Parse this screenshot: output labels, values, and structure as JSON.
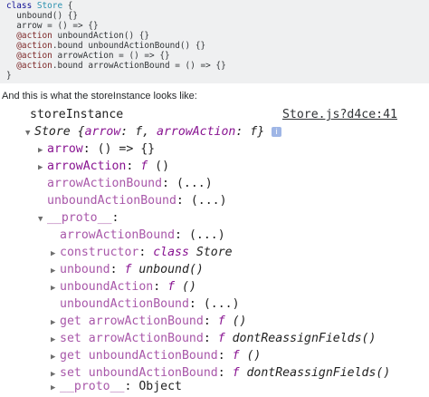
{
  "code_block": {
    "lines": [
      [
        "class ",
        "Store",
        " {"
      ],
      [
        "  unbound() {}"
      ],
      [
        "  arrow = () => {}"
      ],
      [
        "  @action",
        " unboundAction() {}"
      ],
      [
        "  @action",
        ".bound unboundActionBound() {}"
      ],
      [
        "  @action",
        " arrowAction = () => {}"
      ],
      [
        "  @action",
        ".bound arrowActionBound = () => {}"
      ],
      [
        "}"
      ]
    ]
  },
  "caption": "And this is what the storeInstance looks like:",
  "console": {
    "header_label": "storeInstance",
    "source_link": "Store.js?d4ce:41",
    "store_summary": {
      "name": "Store",
      "brace_open": " {",
      "k1": "arrow",
      "k1_val": "f",
      "k2": "arrowAction",
      "k2_val": "f",
      "brace_close": "}",
      "info": "i"
    },
    "rows": [
      {
        "key": "arrow",
        "value": "() => {}"
      },
      {
        "key": "arrowAction",
        "value_fn": "f",
        "value": " ()"
      },
      {
        "key": "arrowActionBound",
        "value": "(...)"
      },
      {
        "key": "unboundActionBound",
        "value": "(...)"
      },
      {
        "key": "__proto__"
      },
      {
        "key": "arrowActionBound",
        "value": "(...)"
      },
      {
        "key": "constructor",
        "value_fn": "class",
        "value": " Store"
      },
      {
        "key": "unbound",
        "value_fn": "f",
        "value": " unbound()"
      },
      {
        "key": "unboundAction",
        "value_fn": "f",
        "value": " ()"
      },
      {
        "key": "unboundActionBound",
        "value": "(...)"
      },
      {
        "prefix": "get",
        "key": "arrowActionBound",
        "value_fn": "f",
        "value": " ()"
      },
      {
        "prefix": "set",
        "key": "arrowActionBound",
        "value_fn": "f",
        "value": " dontReassignFields()"
      },
      {
        "prefix": "get",
        "key": "unboundActionBound",
        "value_fn": "f",
        "value": " ()"
      },
      {
        "prefix": "set",
        "key": "unboundActionBound",
        "value_fn": "f",
        "value": " dontReassignFields()"
      },
      {
        "key": "__proto__",
        "value": "Object"
      }
    ]
  },
  "colors": {
    "code_bg": "#eff0f1",
    "property": "#881391",
    "inherited_property": "#a857a9",
    "info_badge": "#9fb6e6"
  },
  "icons": {
    "expand": "triangle-right-icon",
    "collapse": "triangle-down-icon",
    "info": "info-icon"
  }
}
